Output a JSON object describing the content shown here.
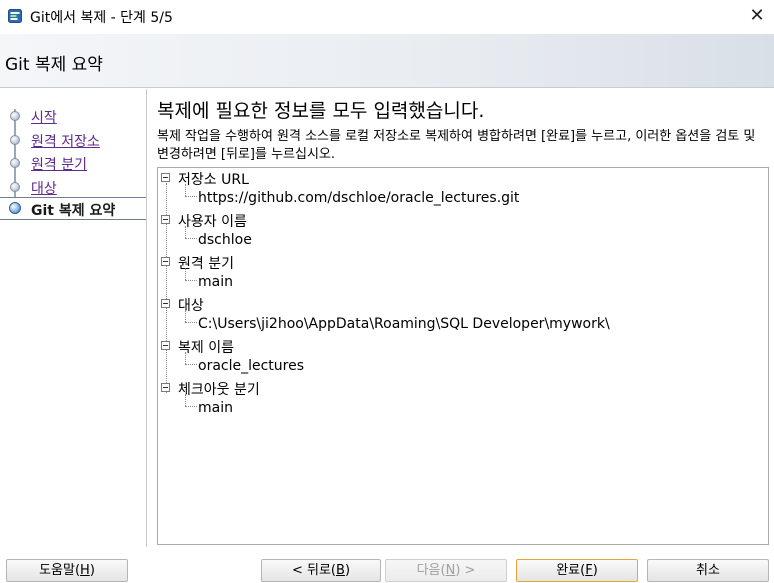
{
  "window": {
    "title": "Git에서 복제 - 단계 5/5",
    "close_glyph": "✕"
  },
  "header": {
    "title": "Git 복제 요약"
  },
  "nav": {
    "items": [
      {
        "label": "시작",
        "state": "link"
      },
      {
        "label": "원격 저장소",
        "state": "link"
      },
      {
        "label": "원격 분기",
        "state": "link"
      },
      {
        "label": "대상",
        "state": "link"
      },
      {
        "label": "Git 복제 요약",
        "state": "current"
      }
    ]
  },
  "main": {
    "heading": "복제에 필요한 정보를 모두 입력했습니다.",
    "description": "복제 작업을 수행하여 원격 소스를 로컬 저장소로 복제하여 병합하려면 [완료]를 누르고, 이러한 옵션을 검토 및 변경하려면 [뒤로]를 누르십시오."
  },
  "summary_tree": [
    {
      "label": "저장소 URL",
      "value": "https://github.com/dschloe/oracle_lectures.git"
    },
    {
      "label": "사용자 이름",
      "value": "dschloe"
    },
    {
      "label": "원격 분기",
      "value": "main"
    },
    {
      "label": "대상",
      "value": "C:\\Users\\ji2hoo\\AppData\\Roaming\\SQL Developer\\mywork\\"
    },
    {
      "label": "복제 이름",
      "value": "oracle_lectures"
    },
    {
      "label": "체크아웃 분기",
      "value": "main"
    }
  ],
  "buttons": {
    "help": {
      "text": "도움말(",
      "mnemonic": "H",
      "suffix": ")"
    },
    "back": {
      "text": "< 뒤로(",
      "mnemonic": "B",
      "suffix": ")"
    },
    "next": {
      "text": "다음(",
      "mnemonic": "N",
      "suffix": ") >"
    },
    "finish": {
      "text": "완료(",
      "mnemonic": "F",
      "suffix": ")"
    },
    "cancel": {
      "text": "취소"
    }
  },
  "colors": {
    "link": "#5e2a8c",
    "default_button_border": "#e8a43a",
    "header_gradient_end": "#d9dfe7"
  },
  "icons": {
    "app": "sql-developer-app-icon",
    "close": "close-icon",
    "nav_bullet": "step-bullet-icon",
    "tree_toggle": "tree-collapse-icon"
  }
}
